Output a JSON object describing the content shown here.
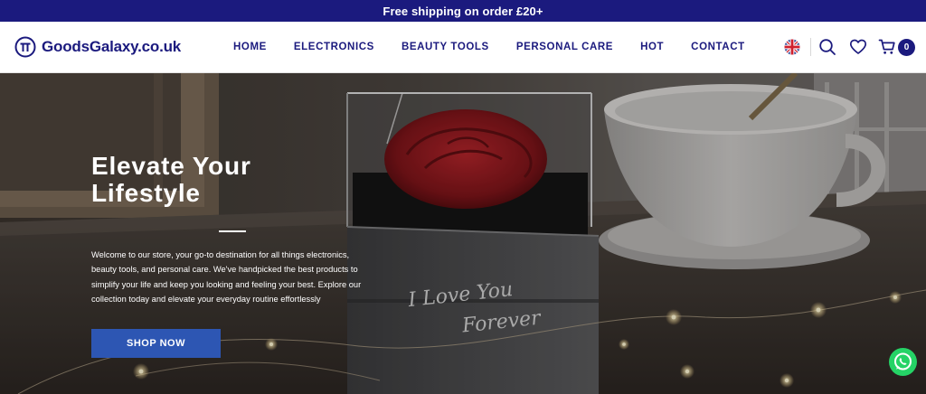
{
  "announcement": {
    "text": "Free shipping on order £20+"
  },
  "header": {
    "logo_text": "GoodsGalaxy.co.uk",
    "nav": [
      {
        "label": "HOME"
      },
      {
        "label": "ELECTRONICS"
      },
      {
        "label": "BEAUTY TOOLS"
      },
      {
        "label": "PERSONAL CARE"
      },
      {
        "label": "HOT"
      },
      {
        "label": "CONTACT"
      }
    ],
    "icons": [
      "uk-flag-icon",
      "search-icon",
      "heart-icon",
      "cart-icon"
    ],
    "cart_count": "0"
  },
  "hero": {
    "title": "Elevate Your Lifestyle",
    "body": "Welcome to our store, your go-to destination for all things electronics, beauty tools, and personal care. We've handpicked the best products to simplify your life and keep you looking and feeling your best. Explore our collection today and elevate your everyday routine effortlessly",
    "cta_label": "SHOP NOW",
    "image_text_line1": "I Love You",
    "image_text_line2": "Forever"
  },
  "floating": {
    "chat_icon": "whatsapp-icon"
  },
  "colors": {
    "brand_navy": "#1b1a7e",
    "cta_blue": "#2d56b3",
    "whatsapp_green": "#25d366"
  }
}
